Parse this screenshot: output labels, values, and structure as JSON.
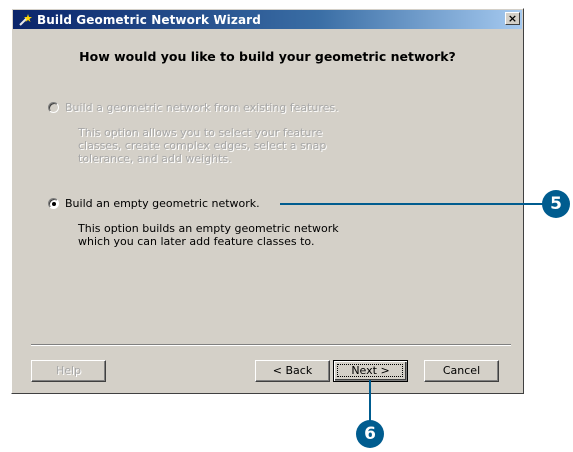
{
  "window": {
    "title": "Build Geometric Network Wizard",
    "close_label": "×"
  },
  "heading": "How would you like to build your geometric network?",
  "options": [
    {
      "label": "Build a geometric network from existing features.",
      "desc1": "This option allows you to select your feature",
      "desc2": "classes, create complex edges, select a snap",
      "desc3": "tolerance, and add weights.",
      "selected": false,
      "enabled": false
    },
    {
      "label": "Build an empty geometric network.",
      "desc1": "This option builds an empty geometric network",
      "desc2": "which you can later add feature classes to.",
      "selected": true,
      "enabled": true
    }
  ],
  "buttons": {
    "help": "Help",
    "back": "< Back",
    "next": "Next >",
    "cancel": "Cancel"
  },
  "callouts": {
    "step5": "5",
    "step6": "6",
    "color": "#005c8f"
  }
}
